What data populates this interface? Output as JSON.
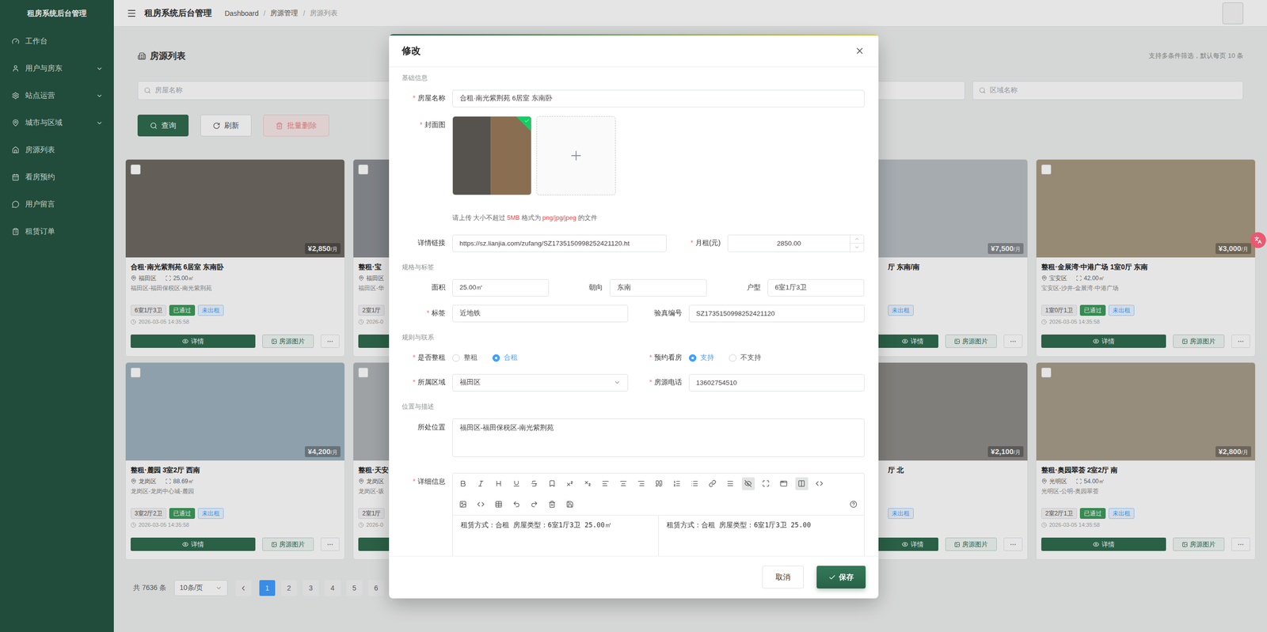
{
  "sidebar": {
    "title": "租房系统后台管理",
    "items": [
      {
        "label": "工作台",
        "kind": "link",
        "selected": false,
        "expanded": false
      },
      {
        "label": "用户与房东",
        "kind": "group",
        "selected": false,
        "expanded": false
      },
      {
        "label": "站点运营",
        "kind": "group",
        "selected": false,
        "expanded": false
      },
      {
        "label": "城市与区域",
        "kind": "group",
        "selected": false,
        "expanded": false
      },
      {
        "label": "房源列表",
        "kind": "link",
        "selected": false,
        "expanded": false
      },
      {
        "label": "看房预约",
        "kind": "link",
        "selected": false,
        "expanded": false
      },
      {
        "label": "用户留言",
        "kind": "link",
        "selected": false,
        "expanded": false
      },
      {
        "label": "租赁订单",
        "kind": "link",
        "selected": false,
        "expanded": false
      }
    ]
  },
  "header": {
    "title": "租房系统后台管理",
    "breadcrumb": [
      "Dashboard",
      "房源管理",
      "房源列表"
    ],
    "separator": "/"
  },
  "page": {
    "title": "房源列表",
    "hint": "支持多条件筛选，默认每页 10 条"
  },
  "filters": [
    {
      "placeholder": "房屋名称"
    },
    {
      "placeholder": ""
    },
    {
      "placeholder": ""
    },
    {
      "placeholder": "区域名称"
    }
  ],
  "actions": [
    {
      "label": "查询",
      "kind": "primary",
      "disabled": false
    },
    {
      "label": "刷新",
      "kind": "default",
      "disabled": false
    },
    {
      "label": "批量删除",
      "kind": "danger",
      "disabled": true
    }
  ],
  "cards": [
    {
      "checked": false,
      "clipped": false,
      "price": "¥2,850",
      "unit": "/月",
      "title": "合租·南光紫荆苑 6居室 东南卧",
      "district": "福田区",
      "area": "25.00㎡",
      "location": "福田区-福田保税区-南光紫荆苑",
      "layout": "6室1厅3卫",
      "audit": "已通过",
      "rent": "未出租",
      "date": "2026-03-05 14:35:58",
      "buttons": [
        "详情",
        "房源图片"
      ]
    },
    {
      "checked": false,
      "clipped": false,
      "price": "",
      "unit": "",
      "title": "整租·宝",
      "district": "福田区",
      "area": "",
      "location": "福田区-华",
      "layout": "2室1厅",
      "audit": "",
      "rent": "",
      "date": "2026-0",
      "buttons": [
        "",
        ""
      ]
    },
    {
      "checked": false,
      "clipped": false,
      "price": "",
      "unit": "",
      "title": "",
      "district": "",
      "area": "",
      "location": "",
      "layout": "",
      "audit": "",
      "rent": "",
      "date": "",
      "buttons": [
        "",
        ""
      ]
    },
    {
      "checked": false,
      "clipped": true,
      "price": "¥7,500",
      "unit": "/月",
      "title": "厅 东南/南",
      "district": "",
      "area": "",
      "location": "",
      "layout": "",
      "audit": "",
      "rent": "未出租",
      "date": "",
      "buttons": [
        "详情",
        "房源图片"
      ]
    },
    {
      "checked": false,
      "clipped": false,
      "price": "¥3,000",
      "unit": "/月",
      "title": "整租·金展湾·中港广场 1室0厅 东南",
      "district": "宝安区",
      "area": "42.00㎡",
      "location": "宝安区-沙井-金展湾·中港广场",
      "layout": "1室0厅1卫",
      "audit": "已通过",
      "rent": "未出租",
      "date": "2026-03-05 14:35:58",
      "buttons": [
        "详情",
        "房源图片"
      ]
    },
    {
      "checked": false,
      "clipped": false,
      "price": "¥4,200",
      "unit": "/月",
      "title": "整租·麓园 3室2厅 西南",
      "district": "龙岗区",
      "area": "88.69㎡",
      "location": "龙岗区-龙岗中心城-麓园",
      "layout": "3室2厅2卫",
      "audit": "已通过",
      "rent": "未出租",
      "date": "2026-03-05 14:35:58",
      "buttons": [
        "详情",
        "房源图片"
      ]
    },
    {
      "checked": false,
      "clipped": false,
      "price": "",
      "unit": "",
      "title": "整租·天安",
      "district": "龙岗区",
      "area": "",
      "location": "龙岗区-坂",
      "layout": "2室1厅",
      "audit": "",
      "rent": "",
      "date": "2026-0",
      "buttons": [
        "",
        ""
      ]
    },
    {
      "checked": false,
      "clipped": false,
      "price": "",
      "unit": "",
      "title": "",
      "district": "",
      "area": "",
      "location": "",
      "layout": "",
      "audit": "",
      "rent": "",
      "date": "",
      "buttons": [
        "",
        ""
      ]
    },
    {
      "checked": false,
      "clipped": true,
      "price": "¥2,100",
      "unit": "/月",
      "title": "厅 北",
      "district": "",
      "area": "",
      "location": "",
      "layout": "",
      "audit": "",
      "rent": "未出租",
      "date": "",
      "buttons": [
        "详情",
        "房源图片"
      ]
    },
    {
      "checked": false,
      "clipped": false,
      "price": "¥2,800",
      "unit": "/月",
      "title": "整租·奥园翠荟 2室2厅 南",
      "district": "光明区",
      "area": "54.00㎡",
      "location": "光明区-公明-奥园翠荟",
      "layout": "2室2厅1卫",
      "audit": "已通过",
      "rent": "未出租",
      "date": "2026-03-05 14:35:58",
      "buttons": [
        "详情",
        "房源图片"
      ]
    }
  ],
  "pagination": {
    "total": "共 7636 条",
    "page_size": "10条/页",
    "pages": [
      {
        "label": "1",
        "selected": true
      },
      {
        "label": "2",
        "selected": false
      },
      {
        "label": "3",
        "selected": false
      },
      {
        "label": "4",
        "selected": false
      },
      {
        "label": "5",
        "selected": false
      },
      {
        "label": "6",
        "selected": false
      }
    ]
  },
  "modal": {
    "title": "修改",
    "required_mark": "*",
    "sections": {
      "basic": "基础信息",
      "spec": "规格与标签",
      "rules": "规则与联系",
      "location": "位置与描述"
    },
    "name": {
      "label": "房屋名称",
      "required": true,
      "value": "合租·南光紫荆苑 6居室 东南卧"
    },
    "cover": {
      "label": "封面图",
      "required": true,
      "uploaded": true,
      "hint": [
        {
          "text": "请上传 大小不超过 ",
          "emphasis": false
        },
        {
          "text": "5MB",
          "emphasis": true
        },
        {
          "text": " 格式为 ",
          "emphasis": false
        },
        {
          "text": "png/jpg/jpeg",
          "emphasis": true
        },
        {
          "text": " 的文件",
          "emphasis": false
        }
      ]
    },
    "link": {
      "label": "详情链接",
      "required": false,
      "value": "https://sz.lianjia.com/zufang/SZ1735150998252421120.ht"
    },
    "rent": {
      "label": "月租(元)",
      "required": true,
      "value": "2850.00"
    },
    "area": {
      "label": "面积",
      "required": false,
      "value": "25.00㎡"
    },
    "orientation": {
      "label": "朝向",
      "required": false,
      "value": "东南"
    },
    "layout": {
      "label": "户型",
      "required": false,
      "value": "6室1厅3卫"
    },
    "tag": {
      "label": "标签",
      "required": true,
      "value": "近地铁"
    },
    "verify": {
      "label": "验真编号",
      "required": false,
      "value": "SZ1735150998252421120"
    },
    "whole": {
      "label": "是否整租",
      "required": true,
      "options": [
        {
          "label": "整租",
          "selected": false
        },
        {
          "label": "合租",
          "selected": true
        }
      ]
    },
    "viewing": {
      "label": "预约看房",
      "required": true,
      "options": [
        {
          "label": "支持",
          "selected": true
        },
        {
          "label": "不支持",
          "selected": false
        }
      ]
    },
    "region": {
      "label": "所属区域",
      "required": true,
      "value": "福田区"
    },
    "phone": {
      "label": "房源电话",
      "required": true,
      "value": "13602754510"
    },
    "address": {
      "label": "所处位置",
      "required": false,
      "value": "福田区-福田保税区-南光紫荆苑"
    },
    "detail": {
      "label": "详细信息",
      "required": true,
      "toolbar": [
        [
          {
            "kind": "bold",
            "active": false
          },
          {
            "kind": "italic",
            "active": false
          },
          {
            "kind": "heading",
            "active": false
          },
          {
            "kind": "underline",
            "active": false
          },
          {
            "kind": "strike",
            "active": false
          },
          {
            "kind": "bookmark",
            "active": false
          },
          {
            "kind": "superscript",
            "active": false
          },
          {
            "kind": "subscript",
            "active": false
          },
          {
            "kind": "align-left",
            "active": false
          },
          {
            "kind": "align-center",
            "active": false
          },
          {
            "kind": "align-right",
            "active": false
          },
          {
            "kind": "quote",
            "active": false
          },
          {
            "kind": "ordered-list",
            "active": false
          },
          {
            "kind": "bullet-list",
            "active": false
          },
          {
            "kind": "link",
            "active": false
          },
          {
            "kind": "menu",
            "active": false
          },
          {
            "kind": "preview",
            "active": true
          },
          {
            "kind": "fullscreen",
            "active": false
          },
          {
            "kind": "window",
            "active": false
          },
          {
            "kind": "split",
            "active": true
          },
          {
            "kind": "source",
            "active": false
          }
        ],
        [
          {
            "kind": "image",
            "active": false
          },
          {
            "kind": "code",
            "active": false
          },
          {
            "kind": "table",
            "active": false
          },
          {
            "kind": "undo",
            "active": false
          },
          {
            "kind": "redo",
            "active": false
          },
          {
            "kind": "clear",
            "active": false
          },
          {
            "kind": "save",
            "active": false
          },
          {
            "kind": "help",
            "active": false
          }
        ]
      ],
      "source": "租赁方式：合租 房屋类型：6室1厅3卫 25.00㎡",
      "preview": "租赁方式：合租 房屋类型：6室1厅3卫 25.00"
    },
    "buttons": {
      "cancel": "取消",
      "save": "保存"
    }
  }
}
